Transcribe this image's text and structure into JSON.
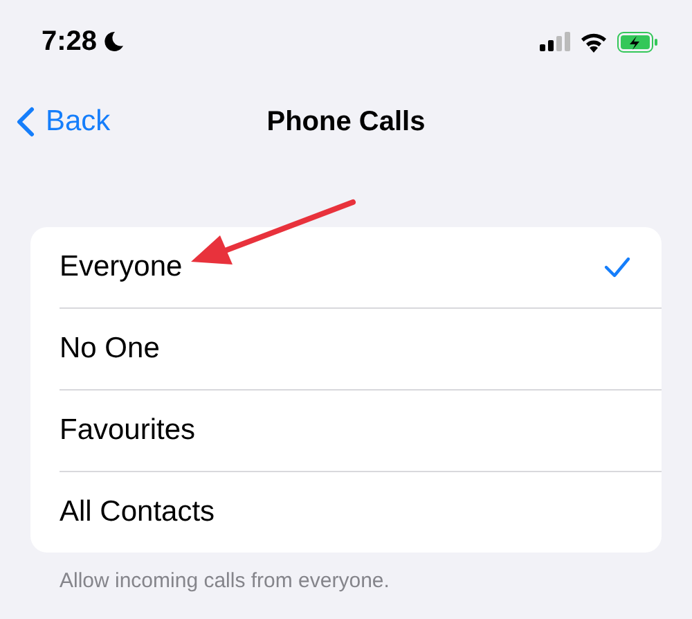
{
  "status_bar": {
    "time": "7:28"
  },
  "nav": {
    "back": "Back",
    "title": "Phone Calls"
  },
  "options": [
    {
      "label": "Everyone",
      "selected": true
    },
    {
      "label": "No One",
      "selected": false
    },
    {
      "label": "Favourites",
      "selected": false
    },
    {
      "label": "All Contacts",
      "selected": false
    }
  ],
  "footer": "Allow incoming calls from everyone."
}
